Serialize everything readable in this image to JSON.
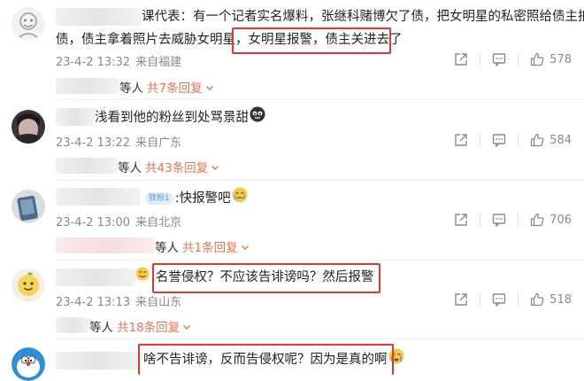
{
  "comments": [
    {
      "text_line1": "课代表：有一个记者实名爆料，张继科赌博欠了债，把女明星的私密照给债主抵",
      "text_line2_pre": "债，债主拿着照片去威胁女明星，",
      "text_line2_box": "女明星报警，债主关进去了",
      "date": "23-4-2 13:32",
      "source": "来自福建",
      "likes": "578",
      "reply_people": "等人",
      "reply_count": "共7条回复"
    },
    {
      "text": "浅看到他的粉丝到处骂景甜",
      "date": "23-4-2 13:22",
      "source": "来自广东",
      "likes": "584",
      "reply_people": "等人",
      "reply_count": "共43条回复"
    },
    {
      "badge": "铁粉1",
      "text": ":快报警吧",
      "date": "23-4-2 13:00",
      "source": "来自北京",
      "likes": "706",
      "reply_people": "等人",
      "reply_count": "共1条回复"
    },
    {
      "text": ":名誉侵权？不应该告诽谤吗？然后报警",
      "date": "23-4-2 13:13",
      "source": "来自山东",
      "likes": "518",
      "reply_people": "等人",
      "reply_count": "共18条回复"
    },
    {
      "text": "啥不告诽谤，反而告侵权呢？因为是真的啊"
    }
  ],
  "icons": [
    "share-icon",
    "comment-icon",
    "like-icon",
    "chevron-down-icon",
    "tear-emoji-icon",
    "smile-emoji-icon",
    "cry-emoji-icon"
  ],
  "colors": {
    "highlight_box": "#e8352f",
    "reply_count": "#eb7350",
    "meta_text": "#888888"
  }
}
